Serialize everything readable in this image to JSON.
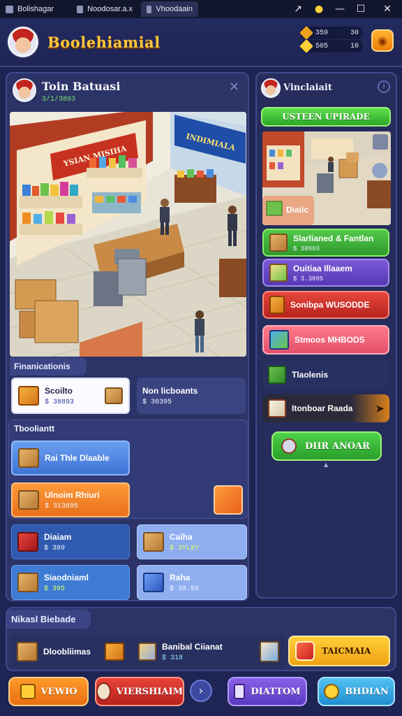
{
  "window": {
    "tabs": [
      {
        "label": "Bolishagar"
      },
      {
        "label": "Noodosar.a.x"
      },
      {
        "label": "Vhoodaain"
      }
    ]
  },
  "header": {
    "title": "Boolehiamial",
    "currency": [
      {
        "label": "359",
        "value": "30"
      },
      {
        "label": "505",
        "value": "10"
      }
    ]
  },
  "store_card": {
    "title": "Toin Batuasi",
    "subtitle": "3/1/3893",
    "scene_signs": [
      "YSIAN MISIHA",
      "INDIMIALA"
    ]
  },
  "financials": {
    "label": "Finanicationis",
    "items": [
      {
        "name": "Scoilto",
        "value": "$ 38893"
      },
      {
        "name": "Non licboants",
        "value": "$ 30395"
      }
    ]
  },
  "toolbox": {
    "label": "Tbooliantt",
    "items": [
      {
        "name": "Rai Thle Dlaable",
        "value": ""
      },
      {
        "name": "Ulnoim Rhiuri",
        "value": "$ 3i3895"
      },
      {
        "name": "Diaiam",
        "value": "$ 389"
      },
      {
        "name": "Caiha",
        "value": "$ 3YL8Y"
      },
      {
        "name": "Siaodniaml",
        "value": "$ 395"
      },
      {
        "name": "Raha",
        "value": "$ 39.99"
      }
    ]
  },
  "side_panel": {
    "title": "Vinclaiait",
    "upgrade_label": "USTEEN UPIRADE",
    "items": [
      {
        "name": "Diaiic",
        "value": ""
      },
      {
        "name": "Slarlianed & Fantlan",
        "value": "$ 38993"
      },
      {
        "name": "Ouitiaa Illaaem",
        "value": "$ 3.3895"
      },
      {
        "name": "Sonibpa WUSODDE",
        "value": ""
      },
      {
        "name": "Stmoos MHBODS",
        "value": ""
      },
      {
        "name": "Tlaolenis",
        "value": ""
      },
      {
        "name": "Itonboar Raada",
        "value": ""
      }
    ],
    "action_label": "DIIR ANOAR"
  },
  "quick_bar": {
    "label": "Nikasl Biebade",
    "items": [
      {
        "name": "Dloobliimas"
      },
      {
        "name": "Banibal Ciianat",
        "value": "$ 318"
      }
    ],
    "cta_label": "TAICMAIA"
  },
  "bottom_nav": [
    {
      "label": "VEWIO"
    },
    {
      "label": "VIERSHIAIM"
    },
    {
      "label": "DIATTOM"
    },
    {
      "label": "BHDIAN"
    }
  ],
  "colors": {
    "background": "#1e2453",
    "panel": "#2b3367",
    "gold": "#ffc93a",
    "green": "#3fc23a",
    "orange": "#f28a22",
    "red": "#d9342c",
    "purple": "#6548c7",
    "blue": "#36a8e7"
  }
}
